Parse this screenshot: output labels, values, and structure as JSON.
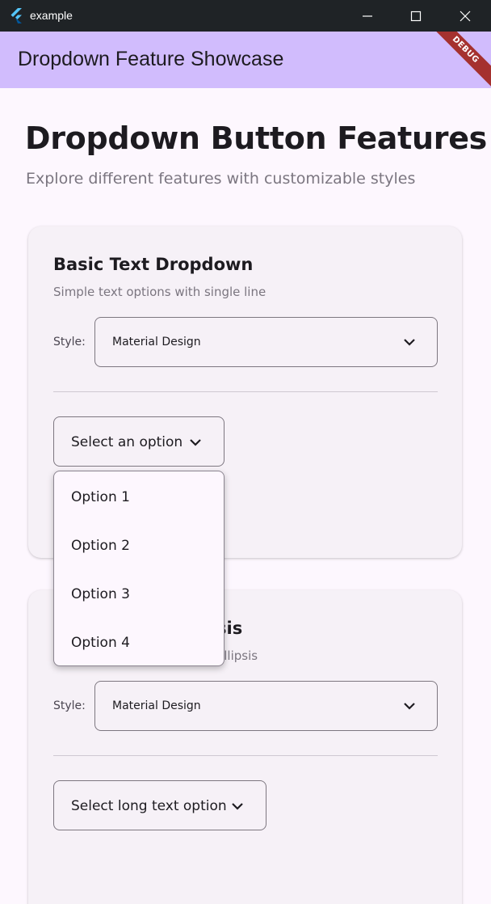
{
  "window": {
    "title": "example",
    "icon": "flutter-logo-icon"
  },
  "appbar": {
    "title": "Dropdown Feature Showcase",
    "debug_label": "DEBUG"
  },
  "page": {
    "title": "Dropdown Button Features",
    "subtitle": "Explore different features with customizable styles"
  },
  "cards": [
    {
      "title": "Basic Text Dropdown",
      "description": "Simple text options with single line",
      "style_label": "Style:",
      "style_value": "Material Design",
      "dropdown_value": "Select an option"
    },
    {
      "title_visible": "sis",
      "description_visible": "ellipsis",
      "style_label": "Style:",
      "style_value": "Material Design",
      "dropdown_value": "Select long text option"
    }
  ],
  "menu": {
    "items": [
      "Option 1",
      "Option 2",
      "Option 3",
      "Option 4"
    ]
  },
  "colors": {
    "appbar": "#d1bcfd",
    "background": "#fdf7fe",
    "card": "#f6f1f7",
    "titlebar": "#1f2326",
    "debug_banner": "#a5312f"
  }
}
